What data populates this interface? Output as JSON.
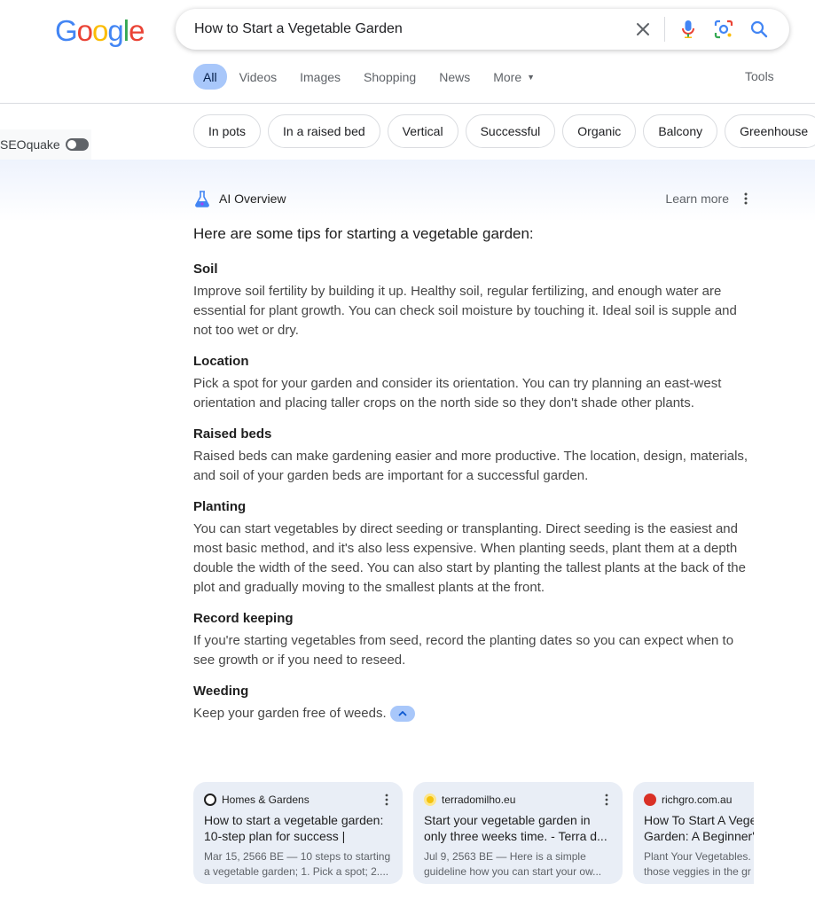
{
  "logo": {
    "letters": [
      "G",
      "o",
      "o",
      "g",
      "l",
      "e"
    ],
    "colors": [
      "#4285F4",
      "#EA4335",
      "#FBBC05",
      "#4285F4",
      "#34A853",
      "#EA4335"
    ]
  },
  "search": {
    "query": "How to Start a Vegetable Garden"
  },
  "tabs": [
    {
      "label": "All",
      "active": true
    },
    {
      "label": "Videos"
    },
    {
      "label": "Images"
    },
    {
      "label": "Shopping"
    },
    {
      "label": "News"
    },
    {
      "label": "More"
    }
  ],
  "tools_label": "Tools",
  "chips": [
    "In pots",
    "In a raised bed",
    "Vertical",
    "Successful",
    "Organic",
    "Balcony",
    "Greenhouse"
  ],
  "seoquake_label": "SEOquake",
  "ai_overview": {
    "title": "AI Overview",
    "learn_more": "Learn more",
    "intro": "Here are some tips for starting a vegetable garden:",
    "sections": [
      {
        "heading": "Soil",
        "text": "Improve soil fertility by building it up. Healthy soil, regular fertilizing, and enough water are essential for plant growth. You can check soil moisture by touching it. Ideal soil is supple and not too wet or dry."
      },
      {
        "heading": "Location",
        "text": "Pick a spot for your garden and consider its orientation. You can try planning an east-west orientation and placing taller crops on the north side so they don't shade other plants."
      },
      {
        "heading": "Raised beds",
        "text": "Raised beds can make gardening easier and more productive. The location, design, materials, and soil of your garden beds are important for a successful garden."
      },
      {
        "heading": "Planting",
        "text": "You can start vegetables by direct seeding or transplanting. Direct seeding is the easiest and most basic method, and it's also less expensive. When planting seeds, plant them at a depth double the width of the seed. You can also start by planting the tallest plants at the back of the plot and gradually moving to the smallest plants at the front."
      },
      {
        "heading": "Record keeping",
        "text": "If you're starting vegetables from seed, record the planting dates so you can expect when to see growth or if you need to reseed."
      },
      {
        "heading": "Weeding",
        "text": "Keep your garden free of weeds."
      }
    ]
  },
  "cards": [
    {
      "source": "Homes & Gardens",
      "title": "How to start a vegetable garden: 10-step plan for success |",
      "snippet_1": "Mar 15, 2566 BE — 10 steps to starting",
      "snippet_2": "a vegetable garden; 1. Pick a spot; 2....",
      "favicon_color": "#1f1f1f"
    },
    {
      "source": "terradomilho.eu",
      "title": "Start your vegetable garden in only three weeks time. - Terra d...",
      "snippet_1": "Jul 9, 2563 BE — Here is a simple",
      "snippet_2": "guideline how you can start your ow...",
      "favicon_color": "#f4c20d"
    },
    {
      "source": "richgro.com.au",
      "title": "How To Start A Vegetable Garden: A Beginner's",
      "snippet_1": "Plant Your Vegetables.",
      "snippet_2": "those veggies in the gr",
      "favicon_color": "#d93025"
    }
  ]
}
